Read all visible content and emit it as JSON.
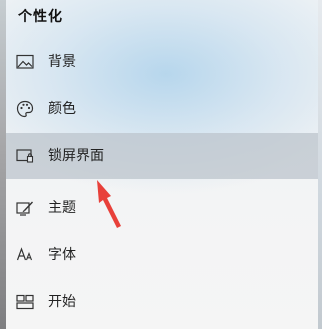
{
  "panel": {
    "title": "个性化"
  },
  "nav": {
    "items": [
      {
        "label": "背景",
        "icon": "picture-icon",
        "selected": false
      },
      {
        "label": "颜色",
        "icon": "palette-icon",
        "selected": false
      },
      {
        "label": "锁屏界面",
        "icon": "lock-screen-icon",
        "selected": true
      },
      {
        "label": "主题",
        "icon": "theme-icon",
        "selected": false
      },
      {
        "label": "字体",
        "icon": "font-icon",
        "selected": false
      },
      {
        "label": "开始",
        "icon": "start-icon",
        "selected": false
      }
    ]
  },
  "colors": {
    "selection": "#bcc4cc",
    "annotation_arrow": "#e8403a"
  }
}
